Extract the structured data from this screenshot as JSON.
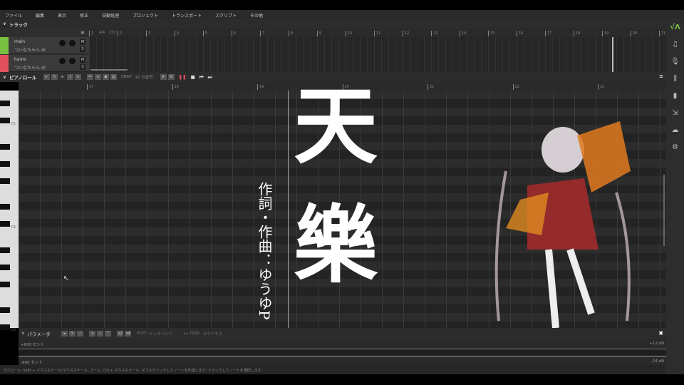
{
  "menu": [
    "ファイル",
    "編集",
    "表示",
    "修正",
    "自動処理",
    "プロジェクト",
    "トランスポート",
    "スクリプト",
    "その他"
  ],
  "track_section": {
    "title": "トラック"
  },
  "top_ruler": {
    "bars": [
      1,
      2,
      3,
      4,
      5,
      6,
      7,
      8,
      9,
      10,
      11,
      12,
      13,
      14,
      15,
      16,
      17,
      18,
      19,
      20,
      21
    ],
    "time_signature": "4/4",
    "tempo": "231"
  },
  "tracks": [
    {
      "name": "main",
      "voice": "ついなちゃん AI",
      "color": "#7ac142",
      "mute": "M",
      "solo": "S"
    },
    {
      "name": "hamo",
      "voice": "ついなちゃん AI",
      "color": "#e0505e",
      "mute": "M",
      "solo": "S"
    }
  ],
  "pianoroll": {
    "title": "ピアノロール",
    "snap_label": "SNAP:",
    "snap_value": "16 分音符",
    "ruler_bars": [
      17,
      18,
      19,
      20,
      21,
      22,
      23
    ],
    "key_labels": [
      "C5",
      "C4",
      "C3"
    ]
  },
  "parameter": {
    "title": "パラメータ",
    "x2": "x2",
    "x4": "x4",
    "edit_label": "EDIT:",
    "edit_value": "ピッチベンド",
    "disp_label": "DISP:",
    "disp_value": "ラウドネス",
    "upper_left": "+600 セント",
    "lower_left": "-600 セント",
    "upper_right": "+12 dB",
    "lower_right": "-24 dB"
  },
  "status": "スクロール: Shift + マウスホイール/マウスホイール; ズーム: Ctrl + マウスホイール; ダブルクリックしてノートを作成します; ドラッグしてノートを選択します。",
  "overlay": {
    "title_1": "天",
    "title_2": "樂",
    "credits": "作詞・作曲：ゆうゆP"
  }
}
